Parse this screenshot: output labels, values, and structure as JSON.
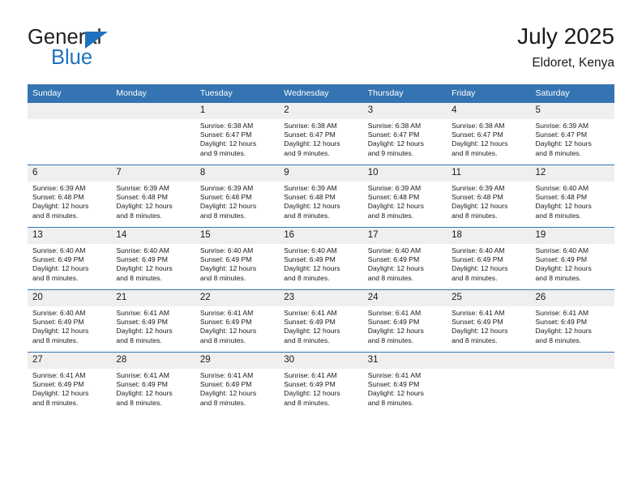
{
  "logo": {
    "word1": "General",
    "word2": "Blue",
    "triangle_icon": "triangle-right-icon",
    "brand_blue": "#1f72bd",
    "word1_color": "#231f20"
  },
  "header": {
    "title": "July 2025",
    "subtitle": "Eldoret, Kenya"
  },
  "theme": {
    "header_blue": "#3574b2",
    "daynum_band": "#efefef",
    "text": "#1a1a1a"
  },
  "calendar": {
    "weekday_headers": [
      "Sunday",
      "Monday",
      "Tuesday",
      "Wednesday",
      "Thursday",
      "Friday",
      "Saturday"
    ],
    "labels": {
      "sunrise": "Sunrise:",
      "sunset": "Sunset:",
      "daylight": "Daylight:"
    },
    "weeks": [
      [
        {
          "day": "",
          "empty": true
        },
        {
          "day": "",
          "empty": true
        },
        {
          "day": "1",
          "sunrise": "Sunrise: 6:38 AM",
          "sunset": "Sunset: 6:47 PM",
          "daylight_l1": "Daylight: 12 hours",
          "daylight_l2": "and 9 minutes."
        },
        {
          "day": "2",
          "sunrise": "Sunrise: 6:38 AM",
          "sunset": "Sunset: 6:47 PM",
          "daylight_l1": "Daylight: 12 hours",
          "daylight_l2": "and 9 minutes."
        },
        {
          "day": "3",
          "sunrise": "Sunrise: 6:38 AM",
          "sunset": "Sunset: 6:47 PM",
          "daylight_l1": "Daylight: 12 hours",
          "daylight_l2": "and 9 minutes."
        },
        {
          "day": "4",
          "sunrise": "Sunrise: 6:38 AM",
          "sunset": "Sunset: 6:47 PM",
          "daylight_l1": "Daylight: 12 hours",
          "daylight_l2": "and 8 minutes."
        },
        {
          "day": "5",
          "sunrise": "Sunrise: 6:39 AM",
          "sunset": "Sunset: 6:47 PM",
          "daylight_l1": "Daylight: 12 hours",
          "daylight_l2": "and 8 minutes."
        }
      ],
      [
        {
          "day": "6",
          "sunrise": "Sunrise: 6:39 AM",
          "sunset": "Sunset: 6:48 PM",
          "daylight_l1": "Daylight: 12 hours",
          "daylight_l2": "and 8 minutes."
        },
        {
          "day": "7",
          "sunrise": "Sunrise: 6:39 AM",
          "sunset": "Sunset: 6:48 PM",
          "daylight_l1": "Daylight: 12 hours",
          "daylight_l2": "and 8 minutes."
        },
        {
          "day": "8",
          "sunrise": "Sunrise: 6:39 AM",
          "sunset": "Sunset: 6:48 PM",
          "daylight_l1": "Daylight: 12 hours",
          "daylight_l2": "and 8 minutes."
        },
        {
          "day": "9",
          "sunrise": "Sunrise: 6:39 AM",
          "sunset": "Sunset: 6:48 PM",
          "daylight_l1": "Daylight: 12 hours",
          "daylight_l2": "and 8 minutes."
        },
        {
          "day": "10",
          "sunrise": "Sunrise: 6:39 AM",
          "sunset": "Sunset: 6:48 PM",
          "daylight_l1": "Daylight: 12 hours",
          "daylight_l2": "and 8 minutes."
        },
        {
          "day": "11",
          "sunrise": "Sunrise: 6:39 AM",
          "sunset": "Sunset: 6:48 PM",
          "daylight_l1": "Daylight: 12 hours",
          "daylight_l2": "and 8 minutes."
        },
        {
          "day": "12",
          "sunrise": "Sunrise: 6:40 AM",
          "sunset": "Sunset: 6:48 PM",
          "daylight_l1": "Daylight: 12 hours",
          "daylight_l2": "and 8 minutes."
        }
      ],
      [
        {
          "day": "13",
          "sunrise": "Sunrise: 6:40 AM",
          "sunset": "Sunset: 6:49 PM",
          "daylight_l1": "Daylight: 12 hours",
          "daylight_l2": "and 8 minutes."
        },
        {
          "day": "14",
          "sunrise": "Sunrise: 6:40 AM",
          "sunset": "Sunset: 6:49 PM",
          "daylight_l1": "Daylight: 12 hours",
          "daylight_l2": "and 8 minutes."
        },
        {
          "day": "15",
          "sunrise": "Sunrise: 6:40 AM",
          "sunset": "Sunset: 6:49 PM",
          "daylight_l1": "Daylight: 12 hours",
          "daylight_l2": "and 8 minutes."
        },
        {
          "day": "16",
          "sunrise": "Sunrise: 6:40 AM",
          "sunset": "Sunset: 6:49 PM",
          "daylight_l1": "Daylight: 12 hours",
          "daylight_l2": "and 8 minutes."
        },
        {
          "day": "17",
          "sunrise": "Sunrise: 6:40 AM",
          "sunset": "Sunset: 6:49 PM",
          "daylight_l1": "Daylight: 12 hours",
          "daylight_l2": "and 8 minutes."
        },
        {
          "day": "18",
          "sunrise": "Sunrise: 6:40 AM",
          "sunset": "Sunset: 6:49 PM",
          "daylight_l1": "Daylight: 12 hours",
          "daylight_l2": "and 8 minutes."
        },
        {
          "day": "19",
          "sunrise": "Sunrise: 6:40 AM",
          "sunset": "Sunset: 6:49 PM",
          "daylight_l1": "Daylight: 12 hours",
          "daylight_l2": "and 8 minutes."
        }
      ],
      [
        {
          "day": "20",
          "sunrise": "Sunrise: 6:40 AM",
          "sunset": "Sunset: 6:49 PM",
          "daylight_l1": "Daylight: 12 hours",
          "daylight_l2": "and 8 minutes."
        },
        {
          "day": "21",
          "sunrise": "Sunrise: 6:41 AM",
          "sunset": "Sunset: 6:49 PM",
          "daylight_l1": "Daylight: 12 hours",
          "daylight_l2": "and 8 minutes."
        },
        {
          "day": "22",
          "sunrise": "Sunrise: 6:41 AM",
          "sunset": "Sunset: 6:49 PM",
          "daylight_l1": "Daylight: 12 hours",
          "daylight_l2": "and 8 minutes."
        },
        {
          "day": "23",
          "sunrise": "Sunrise: 6:41 AM",
          "sunset": "Sunset: 6:49 PM",
          "daylight_l1": "Daylight: 12 hours",
          "daylight_l2": "and 8 minutes."
        },
        {
          "day": "24",
          "sunrise": "Sunrise: 6:41 AM",
          "sunset": "Sunset: 6:49 PM",
          "daylight_l1": "Daylight: 12 hours",
          "daylight_l2": "and 8 minutes."
        },
        {
          "day": "25",
          "sunrise": "Sunrise: 6:41 AM",
          "sunset": "Sunset: 6:49 PM",
          "daylight_l1": "Daylight: 12 hours",
          "daylight_l2": "and 8 minutes."
        },
        {
          "day": "26",
          "sunrise": "Sunrise: 6:41 AM",
          "sunset": "Sunset: 6:49 PM",
          "daylight_l1": "Daylight: 12 hours",
          "daylight_l2": "and 8 minutes."
        }
      ],
      [
        {
          "day": "27",
          "sunrise": "Sunrise: 6:41 AM",
          "sunset": "Sunset: 6:49 PM",
          "daylight_l1": "Daylight: 12 hours",
          "daylight_l2": "and 8 minutes."
        },
        {
          "day": "28",
          "sunrise": "Sunrise: 6:41 AM",
          "sunset": "Sunset: 6:49 PM",
          "daylight_l1": "Daylight: 12 hours",
          "daylight_l2": "and 8 minutes."
        },
        {
          "day": "29",
          "sunrise": "Sunrise: 6:41 AM",
          "sunset": "Sunset: 6:49 PM",
          "daylight_l1": "Daylight: 12 hours",
          "daylight_l2": "and 8 minutes."
        },
        {
          "day": "30",
          "sunrise": "Sunrise: 6:41 AM",
          "sunset": "Sunset: 6:49 PM",
          "daylight_l1": "Daylight: 12 hours",
          "daylight_l2": "and 8 minutes."
        },
        {
          "day": "31",
          "sunrise": "Sunrise: 6:41 AM",
          "sunset": "Sunset: 6:49 PM",
          "daylight_l1": "Daylight: 12 hours",
          "daylight_l2": "and 8 minutes."
        },
        {
          "day": "",
          "empty": true
        },
        {
          "day": "",
          "empty": true
        }
      ]
    ]
  }
}
